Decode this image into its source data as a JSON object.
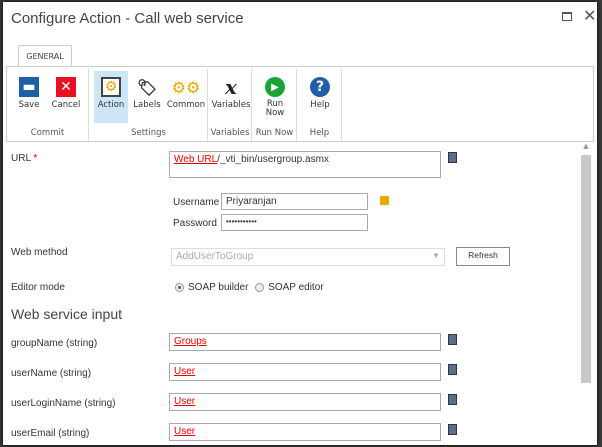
{
  "window": {
    "title": "Configure Action - Call web service"
  },
  "ribbon": {
    "tab": "GENERAL",
    "groups": [
      {
        "label": "Commit",
        "buttons": [
          {
            "label": "Save",
            "icon": "save-icon"
          },
          {
            "label": "Cancel",
            "icon": "cancel-icon"
          }
        ]
      },
      {
        "label": "Settings",
        "buttons": [
          {
            "label": "Action",
            "icon": "action-icon"
          },
          {
            "label": "Labels",
            "icon": "labels-icon"
          },
          {
            "label": "Common",
            "icon": "gears-icon"
          }
        ]
      },
      {
        "label": "Variables",
        "buttons": [
          {
            "label": "Variables",
            "icon": "variables-icon"
          }
        ]
      },
      {
        "label": "Run Now",
        "buttons": [
          {
            "label": "Run Now",
            "icon": "run-icon"
          }
        ]
      },
      {
        "label": "Help",
        "buttons": [
          {
            "label": "Help",
            "icon": "help-icon"
          }
        ]
      }
    ]
  },
  "form": {
    "url_label": "URL",
    "required_mark": "*",
    "url_token": "Web URL",
    "url_rest": "/_vti_bin/usergroup.asmx",
    "username_label": "Username",
    "username": "Priyaranjan",
    "password_label": "Password",
    "password": "•••••••••••",
    "web_method_label": "Web method",
    "web_method": "AddUserToGroup",
    "refresh": "Refresh",
    "editor_mode_label": "Editor mode",
    "soap_builder": "SOAP builder",
    "soap_editor": "SOAP editor",
    "section": "Web service input",
    "inputs": [
      {
        "label": "groupName (string)",
        "value": "Groups"
      },
      {
        "label": "userName (string)",
        "value": "User"
      },
      {
        "label": "userLoginName (string)",
        "value": "User"
      },
      {
        "label": "userEmail (string)",
        "value": "User"
      }
    ]
  }
}
